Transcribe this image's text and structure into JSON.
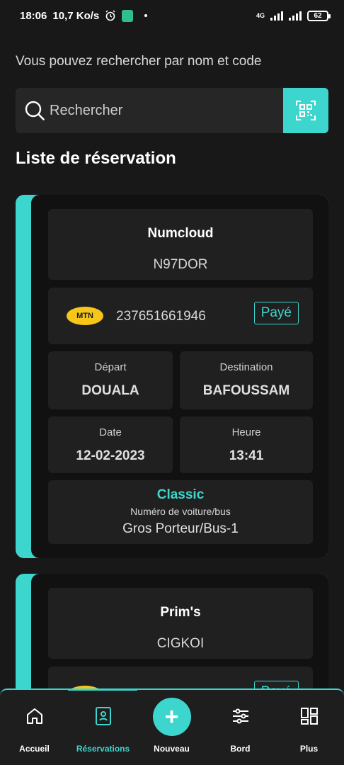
{
  "status_bar": {
    "time": "18:06",
    "speed": "10,7 Ko/s",
    "network": "4G",
    "battery": "62"
  },
  "search": {
    "hint": "Vous pouvez rechercher par nom et code",
    "placeholder": "Rechercher"
  },
  "section_title": "Liste de réservation",
  "reservations": [
    {
      "name": "Numcloud",
      "code": "N97DOR",
      "operator": "MTN",
      "phone": "237651661946",
      "status": "Payé",
      "departure_label": "Départ",
      "departure": "DOUALA",
      "destination_label": "Destination",
      "destination": "BAFOUSSAM",
      "date_label": "Date",
      "date": "12-02-2023",
      "time_label": "Heure",
      "time": "13:41",
      "class": "Classic",
      "vehicle_label": "Numéro de voiture/bus",
      "vehicle": "Gros Porteur/Bus-1"
    },
    {
      "name": "Prim's",
      "code": "CIGKOI",
      "status": "Payé"
    }
  ],
  "bottom_nav": {
    "home": "Accueil",
    "reservations": "Réservations",
    "new": "Nouveau",
    "board": "Bord",
    "more": "Plus"
  },
  "colors": {
    "accent": "#3dd6cf",
    "background": "#181818",
    "card": "#111111",
    "panel": "#202020",
    "mtn_yellow": "#f6c619"
  }
}
